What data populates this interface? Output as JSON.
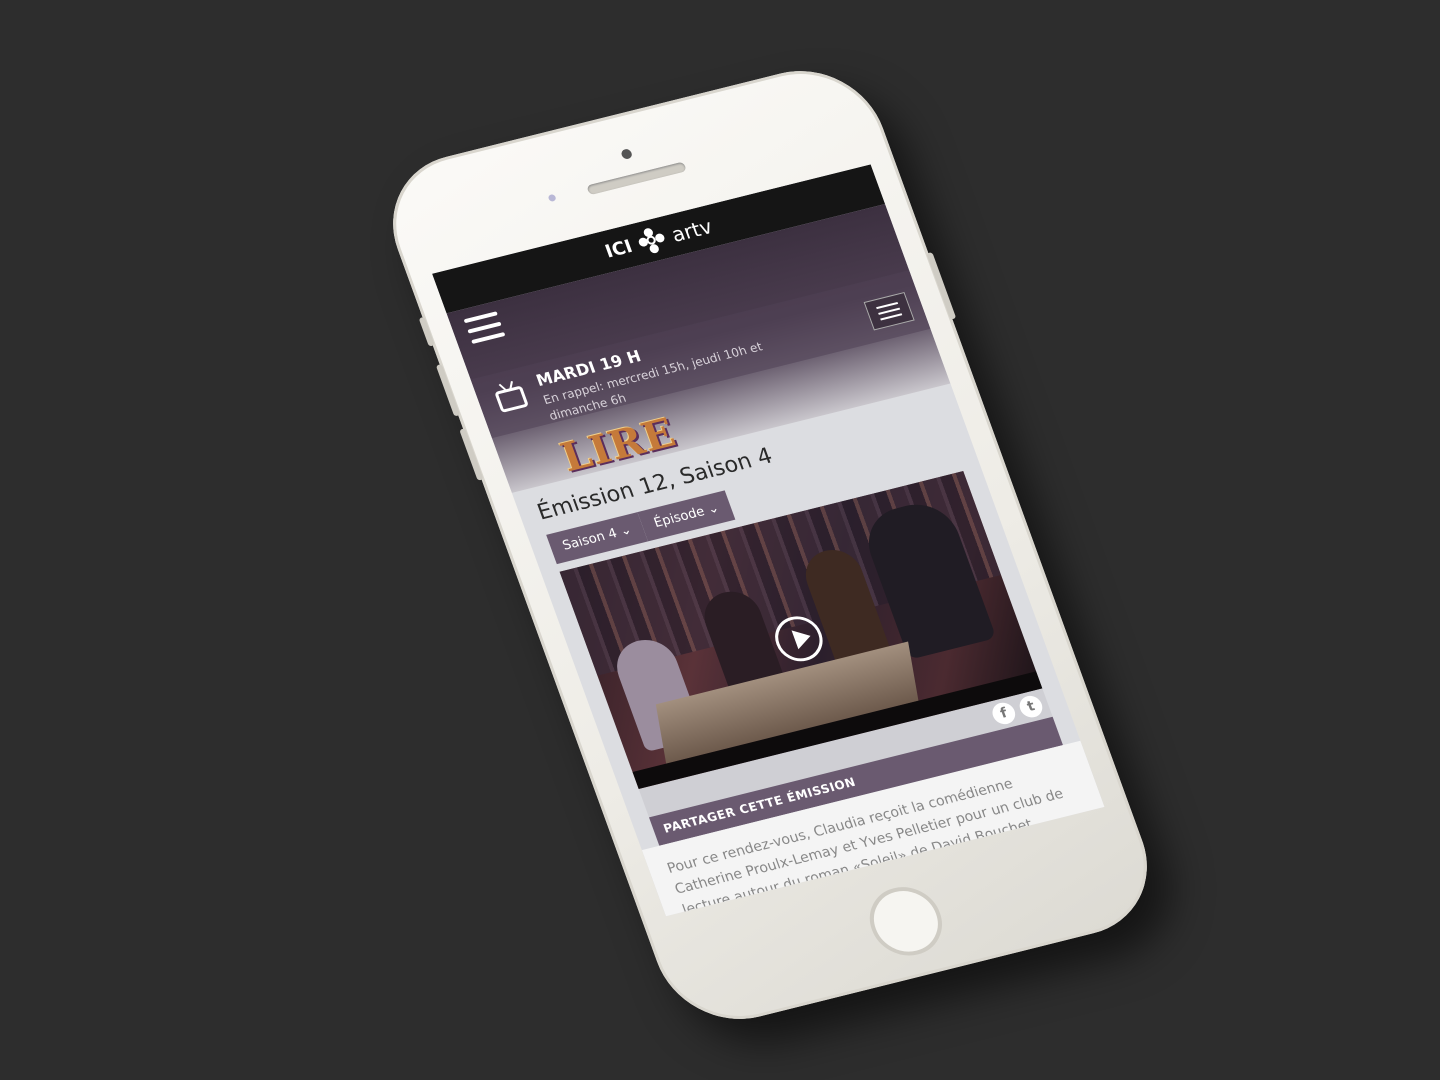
{
  "topbar": {
    "brand_prefix": "ICI",
    "brand_suffix": "artv",
    "logo_icon": "radio-canada-gem-icon"
  },
  "schedule": {
    "title": "MARDI 19 H",
    "subtitle": "En rappel: mercredi 15h, jeudi 10h et dimanche 6h"
  },
  "show": {
    "logo_text": "LIRE",
    "episode_title": "Émission 12, Saison 4",
    "season_select": "Saison 4",
    "episode_select": "Épisode"
  },
  "share": {
    "label": "PARTAGER CETTE ÉMISSION",
    "facebook_glyph": "f",
    "twitter_glyph": "t"
  },
  "description": "Pour ce rendez-vous, Claudia reçoit la comédienne Catherine Proulx-Lemay et Yves Pelletier pour un club de lecture autour du roman «Soleil» de David Bouchet. Jocelyne",
  "icons": {
    "menu": "hamburger-icon",
    "tv": "tv-icon",
    "play": "play-icon",
    "expand": "plus-icon"
  }
}
